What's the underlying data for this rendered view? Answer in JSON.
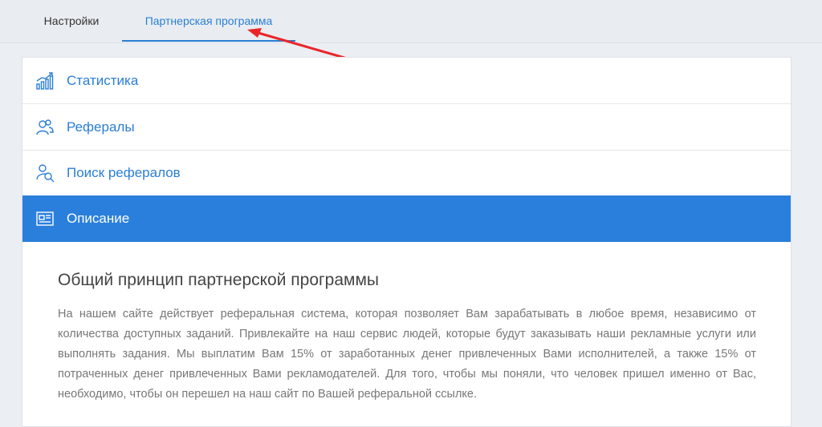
{
  "tabs": [
    {
      "label": "Настройки",
      "active": false
    },
    {
      "label": "Партнерская программа",
      "active": true
    }
  ],
  "menu": {
    "items": [
      {
        "label": "Статистика",
        "icon": "chart-growth-icon",
        "active": false
      },
      {
        "label": "Рефералы",
        "icon": "referrals-icon",
        "active": false
      },
      {
        "label": "Поиск рефералов",
        "icon": "user-search-icon",
        "active": false
      },
      {
        "label": "Описание",
        "icon": "document-icon",
        "active": true
      }
    ]
  },
  "content": {
    "title": "Общий принцип партнерской программы",
    "paragraph": "На нашем сайте действует реферальная система, которая позволяет Вам зарабатывать в любое время, независимо от количества доступных заданий. Привлекайте на наш сервис людей, которые будут заказывать наши рекламные услуги или выполнять задания. Мы выплатим Вам 15% от заработанных денег привлеченных Вами исполнителей, а также 15% от потраченных денег привлеченных Вами рекламодателей. Для того, чтобы мы поняли, что человек пришел именно от Вас, необходимо, чтобы он перешел на наш сайт по Вашей реферальной ссылке."
  },
  "colors": {
    "accent": "#2a7fdc",
    "annotation_arrow": "#e8262a"
  }
}
